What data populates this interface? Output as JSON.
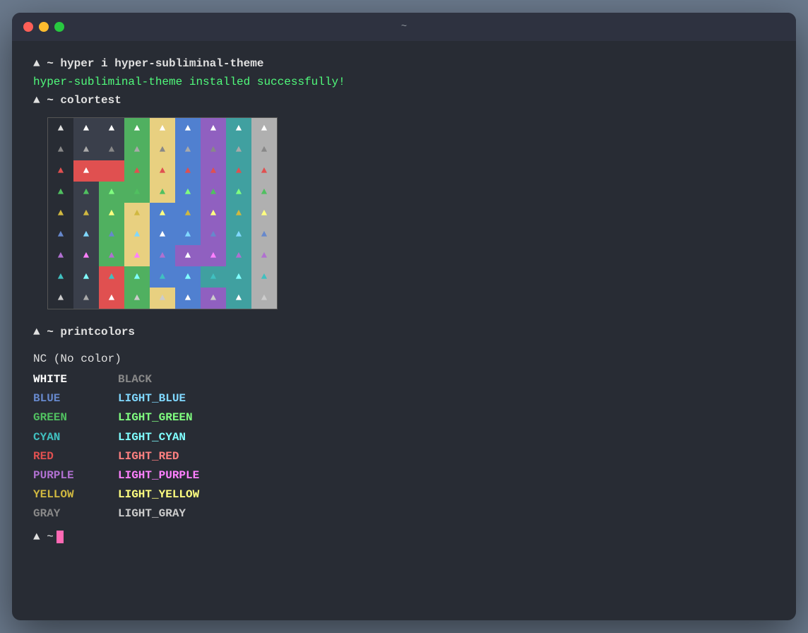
{
  "window": {
    "title": "~",
    "traffic_lights": {
      "close": "close",
      "minimize": "minimize",
      "maximize": "maximize"
    }
  },
  "terminal": {
    "cmd1": "▲ ~ hyper i hyper-subliminal-theme",
    "output1": "hyper-subliminal-theme installed successfully!",
    "cmd2": "▲ ~ colortest",
    "cmd3": "▲ ~ printcolors",
    "nc_line": "NC (No color)",
    "colors": [
      {
        "left": "WHITE",
        "left_class": "c-white",
        "right": "BLACK",
        "right_class": "c-black"
      },
      {
        "left": "BLUE",
        "left_class": "c-blue",
        "right": "LIGHT_BLUE",
        "right_class": "c-light-blue"
      },
      {
        "left": "GREEN",
        "left_class": "c-green",
        "right": "LIGHT_GREEN",
        "right_class": "c-light-green"
      },
      {
        "left": "CYAN",
        "left_class": "c-cyan",
        "right": "LIGHT_CYAN",
        "right_class": "c-light-cyan"
      },
      {
        "left": "RED",
        "left_class": "c-red",
        "right": "LIGHT_RED",
        "right_class": "c-light-red"
      },
      {
        "left": "PURPLE",
        "left_class": "c-purple",
        "right": "LIGHT_PURPLE",
        "right_class": "c-light-purple"
      },
      {
        "left": "YELLOW",
        "left_class": "c-yellow",
        "right": "LIGHT_YELLOW",
        "right_class": "c-light-yellow"
      },
      {
        "left": "GRAY",
        "left_class": "c-gray",
        "right": "LIGHT_GRAY",
        "right_class": "c-light-gray"
      }
    ],
    "prompt_end": "▲ ~"
  }
}
